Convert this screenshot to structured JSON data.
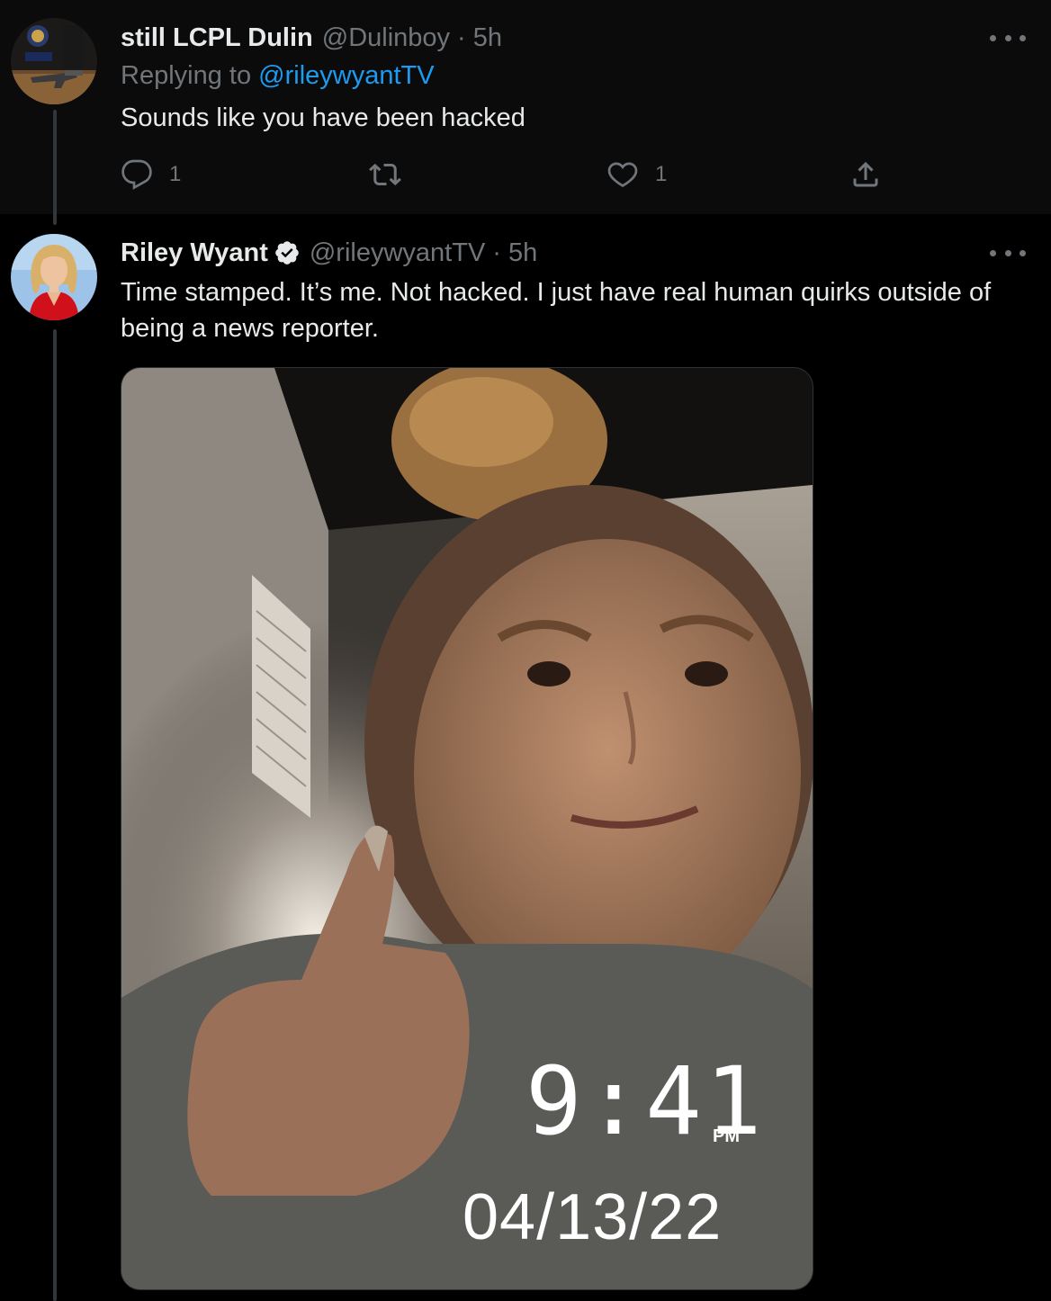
{
  "colors": {
    "background": "#000000",
    "text": "#e7e9ea",
    "muted": "#71767b",
    "link": "#1d9bf0",
    "verified": "#e7e9ea"
  },
  "reply_tweet": {
    "display_name": "still LCPL Dulin",
    "handle": "@Dulinboy",
    "separator": "·",
    "time": "5h",
    "replying_prefix": "Replying to ",
    "replying_mention": "@rileywyantTV",
    "text": "Sounds like you have been hacked",
    "reply_count": "1",
    "like_count": "1",
    "icons": [
      "more-icon",
      "reply-icon",
      "retweet-icon",
      "like-icon",
      "share-icon"
    ]
  },
  "main_tweet": {
    "display_name": "Riley Wyant",
    "verified": true,
    "handle": "@rileywyantTV",
    "separator": "·",
    "time": "5h",
    "text": "Time stamped. It’s me. Not hacked. I just have real human quirks outside of being a news reporter.",
    "media": {
      "clock_time": "9:41",
      "ampm": "PM",
      "date": "04/13/22"
    },
    "icons": [
      "verified-badge-icon",
      "more-icon"
    ]
  }
}
